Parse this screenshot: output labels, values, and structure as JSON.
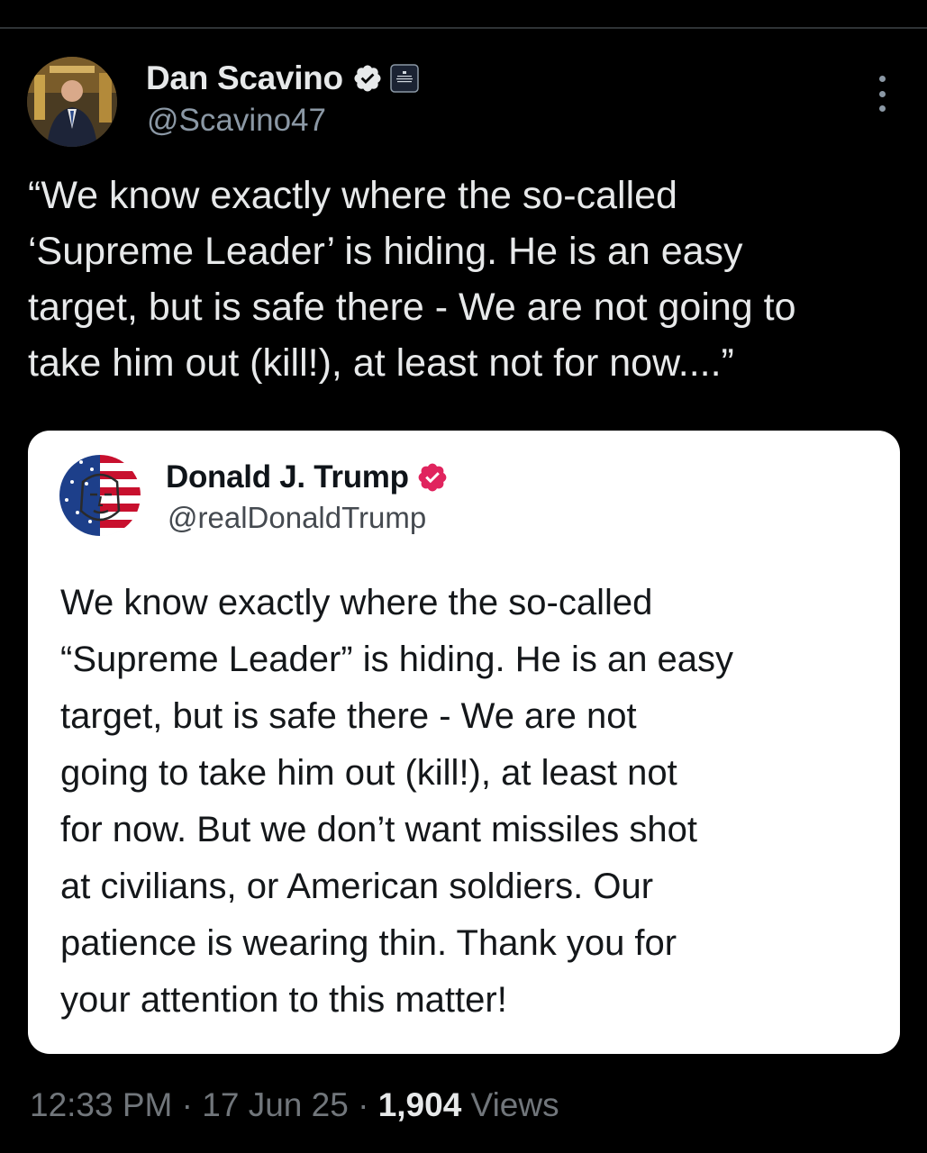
{
  "author": {
    "display_name": "Dan Scavino",
    "handle": "@Scavino47",
    "avatar": "avatar-photo",
    "verified_icon": "verified-badge-icon",
    "affiliation_icon": "white-house-badge-icon"
  },
  "tweet": {
    "text": "“We know exactly where the so-called\n‘Supreme Leader’ is hiding. He is an easy\ntarget, but is safe there - We are not going to\ntake him out (kill!), at least not for now....”"
  },
  "quoted": {
    "display_name": "Donald J. Trump",
    "handle": "@realDonaldTrump",
    "avatar": "flag-portrait-avatar",
    "verified_icon": "verified-badge-icon",
    "text": "We know exactly where the so-called\n“Supreme Leader” is hiding. He is an easy\ntarget, but is safe there - We are not\ngoing to take him out (kill!), at least not\nfor now. But we don’t want missiles shot\nat civilians, or American soldiers. Our\npatience is wearing thin. Thank you for\nyour attention to this matter!"
  },
  "meta": {
    "time": "12:33 PM",
    "separator": " · ",
    "date": "17 Jun 25",
    "views_count": "1,904",
    "views_label": " Views"
  },
  "colors": {
    "background": "#000000",
    "verified_blue": "#1d9bf0",
    "verified_pink": "#e0245e",
    "muted_text": "#71767b"
  }
}
